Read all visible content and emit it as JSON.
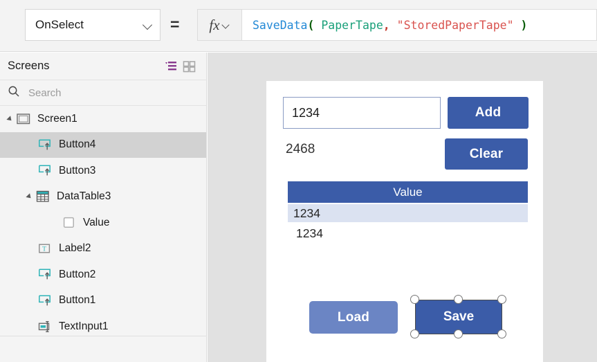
{
  "formula_bar": {
    "property": "OnSelect",
    "equals": "=",
    "fx_label": "fx",
    "formula_full": "SaveData( PaperTape, \"StoredPaperTape\" )",
    "tokens": {
      "fn": "SaveData",
      "open_paren": "(",
      "arg1": "PaperTape",
      "comma": ",",
      "arg2": "\"StoredPaperTape\"",
      "close_paren": ")"
    },
    "colors": {
      "function": "#2389d6",
      "paren": "#0b5e0b",
      "identifier": "#1aa07a",
      "string": "#d9534f",
      "comma": "#c3392b"
    }
  },
  "sidebar": {
    "title": "Screens",
    "search_placeholder": "Search",
    "view_toggle": {
      "tree_icon": "tree-view-icon",
      "thumbnail_icon": "thumbnail-view-icon",
      "active_color": "#8a3b8f"
    },
    "tree": [
      {
        "label": "Screen1",
        "icon": "screen-icon",
        "depth": 0,
        "expandable": true,
        "selected": false
      },
      {
        "label": "Button4",
        "icon": "button-icon",
        "depth": 1,
        "expandable": false,
        "selected": true
      },
      {
        "label": "Button3",
        "icon": "button-icon",
        "depth": 1,
        "expandable": false,
        "selected": false
      },
      {
        "label": "DataTable3",
        "icon": "datatable-icon",
        "depth": 1,
        "expandable": true,
        "selected": false
      },
      {
        "label": "Value",
        "icon": "checkbox-icon",
        "depth": 2,
        "expandable": false,
        "selected": false
      },
      {
        "label": "Label2",
        "icon": "label-icon",
        "depth": 1,
        "expandable": false,
        "selected": false
      },
      {
        "label": "Button2",
        "icon": "button-icon",
        "depth": 1,
        "expandable": false,
        "selected": false
      },
      {
        "label": "Button1",
        "icon": "button-icon",
        "depth": 1,
        "expandable": false,
        "selected": false
      },
      {
        "label": "TextInput1",
        "icon": "textinput-icon",
        "depth": 1,
        "expandable": false,
        "selected": false
      }
    ]
  },
  "canvas": {
    "background": "#e1e1e1",
    "screen": {
      "text_input": {
        "value": "1234"
      },
      "add_button": {
        "label": "Add",
        "color": "#3b5ca8"
      },
      "clear_button": {
        "label": "Clear",
        "color": "#3b5ca8"
      },
      "sum_label": {
        "value": "2468"
      },
      "data_table": {
        "header": "Value",
        "header_color": "#3b5ca8",
        "rows": [
          {
            "value": "1234",
            "selected": true
          },
          {
            "value": "1234",
            "selected": false
          }
        ]
      },
      "load_button": {
        "label": "Load",
        "color": "#6b85c4"
      },
      "save_button": {
        "label": "Save",
        "color": "#3b5ca8",
        "selected": true,
        "handle_count": 6
      }
    }
  }
}
